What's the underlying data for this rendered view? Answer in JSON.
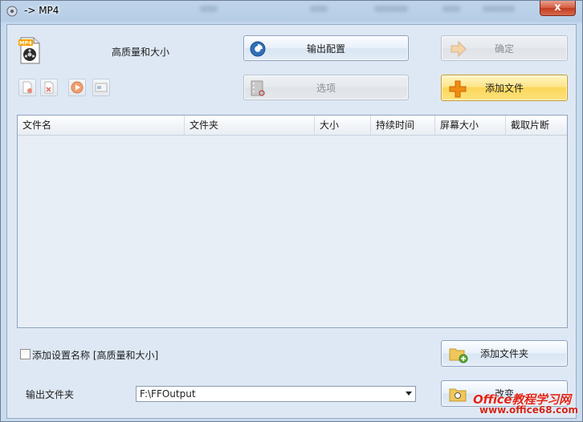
{
  "window": {
    "title": "-> MP4",
    "close_glyph": "x",
    "accent_color": "#fbd65a",
    "titlebar_color": "#bfd4ea"
  },
  "profile": {
    "format_icon": "mp4-file-icon",
    "format_badge": "MP4",
    "name": "高质量和大小"
  },
  "buttons": {
    "output_config": "输出配置",
    "options": "选项",
    "ok": "确定",
    "add_file": "添加文件",
    "add_folder": "添加文件夹",
    "change": "改变"
  },
  "toolbar": {
    "items": [
      {
        "icon": "remove-file-icon"
      },
      {
        "icon": "clear-list-icon"
      },
      {
        "icon": "play-icon"
      },
      {
        "icon": "media-info-icon"
      }
    ]
  },
  "file_table": {
    "columns": [
      "文件名",
      "文件夹",
      "大小",
      "持续时间",
      "屏幕大小",
      "截取片断"
    ],
    "rows": []
  },
  "options": {
    "append_setting_name_label": "添加设置名称 [高质量和大小]",
    "append_setting_name_checked": false
  },
  "output": {
    "label": "输出文件夹",
    "folder": "F:\\FFOutput"
  },
  "watermark": {
    "brand": "Office教程学习网",
    "url": "www.office68.com"
  }
}
